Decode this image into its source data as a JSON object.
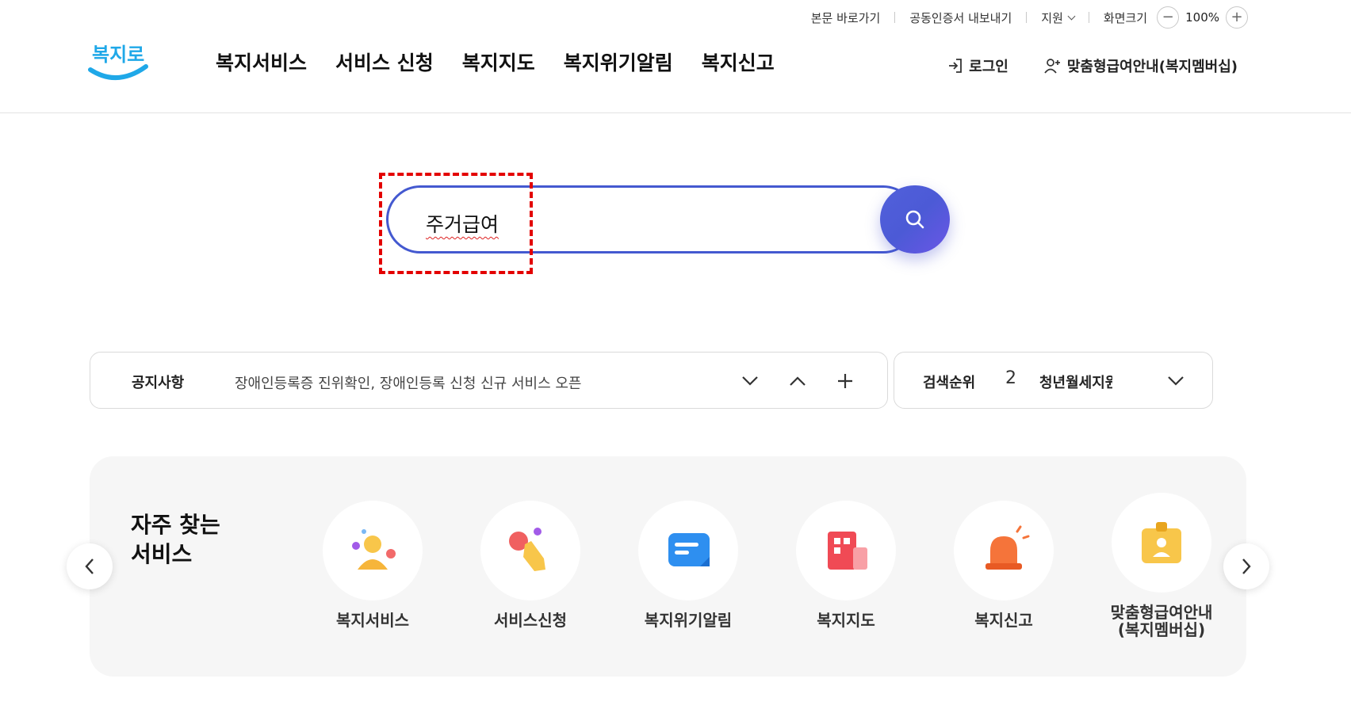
{
  "util": {
    "skip": "본문 바로가기",
    "cert": "공동인증서 내보내기",
    "support": "지원",
    "screen_size": "화면크기",
    "zoom_out": "−",
    "zoom_level": "100%",
    "zoom_in": "+"
  },
  "logo": {
    "text": "복지로"
  },
  "gnb": [
    "복지서비스",
    "서비스 신청",
    "복지지도",
    "복지위기알림",
    "복지신고"
  ],
  "header_right": {
    "login": "로그인",
    "membership": "맞춤형급여안내(복지멤버십)"
  },
  "search": {
    "value": "주거급여"
  },
  "notice": {
    "label": "공지사항",
    "text": "장애인등록증 진위확인, 장애인등록 신청 신규 서비스 오픈"
  },
  "ranking": {
    "label": "검색순위",
    "number": "2",
    "term": "청년월세지원"
  },
  "services": {
    "title": "자주 찾는 서비스",
    "items": [
      {
        "label": "복지서비스",
        "icon": "welfare-service-icon"
      },
      {
        "label": "서비스신청",
        "icon": "service-apply-icon"
      },
      {
        "label": "복지위기알림",
        "icon": "crisis-alert-icon"
      },
      {
        "label": "복지지도",
        "icon": "welfare-map-icon"
      },
      {
        "label": "복지신고",
        "icon": "siren-icon"
      },
      {
        "label": "맞춤형급여안내 (복지멤버십)",
        "icon": "membership-badge-icon"
      }
    ]
  },
  "colors": {
    "primary": "#4459d0",
    "highlight": "#e30000",
    "logo_blue": "#1fa8e8"
  }
}
